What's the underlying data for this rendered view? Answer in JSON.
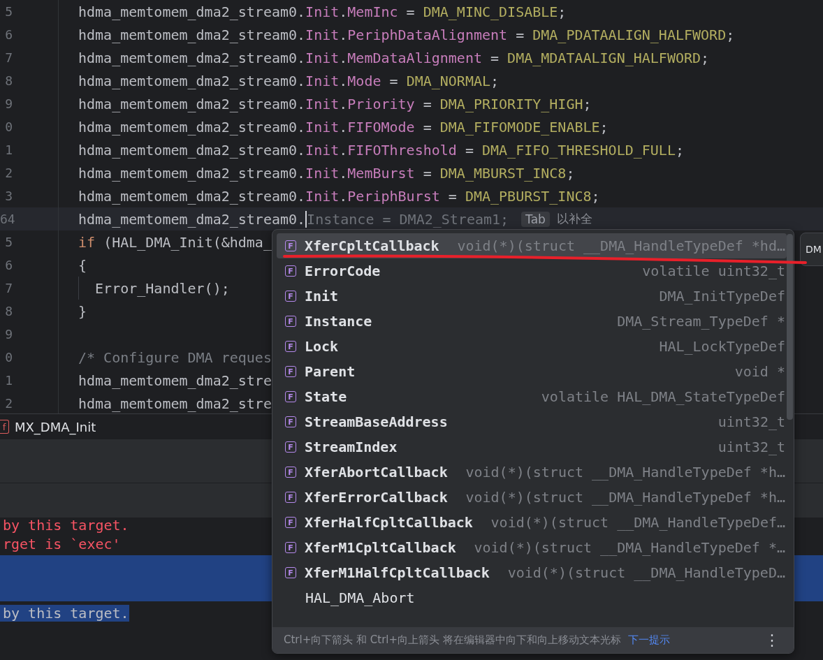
{
  "editor": {
    "lines": [
      {
        "number": "5",
        "current": false,
        "segments": [
          {
            "kind": "plain",
            "text": "hdma_memtomem_dma2_stream0."
          },
          {
            "kind": "field",
            "text": "Init"
          },
          {
            "kind": "plain",
            "text": "."
          },
          {
            "kind": "field",
            "text": "MemInc"
          },
          {
            "kind": "plain",
            "text": " = "
          },
          {
            "kind": "macro",
            "text": "DMA_MINC_DISABLE"
          },
          {
            "kind": "plain",
            "text": ";"
          }
        ]
      },
      {
        "number": "6",
        "current": false,
        "segments": [
          {
            "kind": "plain",
            "text": "hdma_memtomem_dma2_stream0."
          },
          {
            "kind": "field",
            "text": "Init"
          },
          {
            "kind": "plain",
            "text": "."
          },
          {
            "kind": "field",
            "text": "PeriphDataAlignment"
          },
          {
            "kind": "plain",
            "text": " = "
          },
          {
            "kind": "macro",
            "text": "DMA_PDATAALIGN_HALFWORD"
          },
          {
            "kind": "plain",
            "text": ";"
          }
        ]
      },
      {
        "number": "7",
        "current": false,
        "segments": [
          {
            "kind": "plain",
            "text": "hdma_memtomem_dma2_stream0."
          },
          {
            "kind": "field",
            "text": "Init"
          },
          {
            "kind": "plain",
            "text": "."
          },
          {
            "kind": "field",
            "text": "MemDataAlignment"
          },
          {
            "kind": "plain",
            "text": " = "
          },
          {
            "kind": "macro",
            "text": "DMA_MDATAALIGN_HALFWORD"
          },
          {
            "kind": "plain",
            "text": ";"
          }
        ]
      },
      {
        "number": "8",
        "current": false,
        "segments": [
          {
            "kind": "plain",
            "text": "hdma_memtomem_dma2_stream0."
          },
          {
            "kind": "field",
            "text": "Init"
          },
          {
            "kind": "plain",
            "text": "."
          },
          {
            "kind": "field",
            "text": "Mode"
          },
          {
            "kind": "plain",
            "text": " = "
          },
          {
            "kind": "macro",
            "text": "DMA_NORMAL"
          },
          {
            "kind": "plain",
            "text": ";"
          }
        ]
      },
      {
        "number": "9",
        "current": false,
        "segments": [
          {
            "kind": "plain",
            "text": "hdma_memtomem_dma2_stream0."
          },
          {
            "kind": "field",
            "text": "Init"
          },
          {
            "kind": "plain",
            "text": "."
          },
          {
            "kind": "field",
            "text": "Priority"
          },
          {
            "kind": "plain",
            "text": " = "
          },
          {
            "kind": "macro",
            "text": "DMA_PRIORITY_HIGH"
          },
          {
            "kind": "plain",
            "text": ";"
          }
        ]
      },
      {
        "number": "0",
        "current": false,
        "segments": [
          {
            "kind": "plain",
            "text": "hdma_memtomem_dma2_stream0."
          },
          {
            "kind": "field",
            "text": "Init"
          },
          {
            "kind": "plain",
            "text": "."
          },
          {
            "kind": "field",
            "text": "FIFOMode"
          },
          {
            "kind": "plain",
            "text": " = "
          },
          {
            "kind": "macro",
            "text": "DMA_FIFOMODE_ENABLE"
          },
          {
            "kind": "plain",
            "text": ";"
          }
        ]
      },
      {
        "number": "1",
        "current": false,
        "segments": [
          {
            "kind": "plain",
            "text": "hdma_memtomem_dma2_stream0."
          },
          {
            "kind": "field",
            "text": "Init"
          },
          {
            "kind": "plain",
            "text": "."
          },
          {
            "kind": "field",
            "text": "FIFOThreshold"
          },
          {
            "kind": "plain",
            "text": " = "
          },
          {
            "kind": "macro",
            "text": "DMA_FIFO_THRESHOLD_FULL"
          },
          {
            "kind": "plain",
            "text": ";"
          }
        ]
      },
      {
        "number": "2",
        "current": false,
        "segments": [
          {
            "kind": "plain",
            "text": "hdma_memtomem_dma2_stream0."
          },
          {
            "kind": "field",
            "text": "Init"
          },
          {
            "kind": "plain",
            "text": "."
          },
          {
            "kind": "field",
            "text": "MemBurst"
          },
          {
            "kind": "plain",
            "text": " = "
          },
          {
            "kind": "macro",
            "text": "DMA_MBURST_INC8"
          },
          {
            "kind": "plain",
            "text": ";"
          }
        ]
      },
      {
        "number": "3",
        "current": false,
        "segments": [
          {
            "kind": "plain",
            "text": "hdma_memtomem_dma2_stream0."
          },
          {
            "kind": "field",
            "text": "Init"
          },
          {
            "kind": "plain",
            "text": "."
          },
          {
            "kind": "field",
            "text": "PeriphBurst"
          },
          {
            "kind": "plain",
            "text": " = "
          },
          {
            "kind": "macro",
            "text": "DMA_PBURST_INC8"
          },
          {
            "kind": "plain",
            "text": ";"
          }
        ]
      },
      {
        "number": "64",
        "current": true,
        "segments": [
          {
            "kind": "plain",
            "text": "hdma_memtomem_dma2_stream0."
          },
          {
            "kind": "ghost",
            "text": "Instance = DMA2_Stream1;"
          }
        ],
        "hint": {
          "key": "Tab",
          "text": "以补全"
        }
      },
      {
        "number": "5",
        "current": false,
        "segments": [
          {
            "kind": "keyword",
            "text": "if"
          },
          {
            "kind": "plain",
            "text": " (HAL_DMA_Init(&hdma_"
          }
        ]
      },
      {
        "number": "6",
        "current": false,
        "segments": [
          {
            "kind": "plain",
            "text": "{"
          }
        ]
      },
      {
        "number": "7",
        "current": false,
        "guide": true,
        "segments": [
          {
            "kind": "plain",
            "text": "  Error_Handler();"
          }
        ]
      },
      {
        "number": "8",
        "current": false,
        "segments": [
          {
            "kind": "plain",
            "text": "}"
          }
        ]
      },
      {
        "number": "9",
        "current": false
      },
      {
        "number": "0",
        "current": false,
        "segments": [
          {
            "kind": "comment",
            "text": "/* Configure DMA reques"
          }
        ]
      },
      {
        "number": "1",
        "current": false,
        "segments": [
          {
            "kind": "plain",
            "text": "hdma_memtomem_dma2_stre"
          }
        ]
      },
      {
        "number": "2",
        "current": false,
        "segments": [
          {
            "kind": "plain",
            "text": "hdma_memtomem_dma2_stre"
          }
        ]
      }
    ]
  },
  "breadcrumb": {
    "icon": "f",
    "label": "MX_DMA_Init"
  },
  "terminal": {
    "lines": [
      {
        "kind": "error",
        "text": "by this target.",
        "selected": false
      },
      {
        "kind": "error",
        "text": "rget is `exec'",
        "selected": false
      },
      {
        "kind": "blank",
        "selected": true
      },
      {
        "kind": "blank",
        "selected": true
      },
      {
        "kind": "plain",
        "text": "by this target.",
        "selected": true
      }
    ]
  },
  "completion": {
    "items": [
      {
        "kind": "field",
        "badge": "F",
        "name": "XferCpltCallback",
        "type": "void(*)(struct __DMA_HandleTypeDef *hd…",
        "selected": true
      },
      {
        "kind": "field",
        "badge": "F",
        "name": "ErrorCode",
        "type": "volatile uint32_t",
        "selected": false
      },
      {
        "kind": "field",
        "badge": "F",
        "name": "Init",
        "type": "DMA_InitTypeDef",
        "selected": false
      },
      {
        "kind": "field",
        "badge": "F",
        "name": "Instance",
        "type": "DMA_Stream_TypeDef *",
        "selected": false
      },
      {
        "kind": "field",
        "badge": "F",
        "name": "Lock",
        "type": "HAL_LockTypeDef",
        "selected": false
      },
      {
        "kind": "field",
        "badge": "F",
        "name": "Parent",
        "type": "void *",
        "selected": false
      },
      {
        "kind": "field",
        "badge": "F",
        "name": "State",
        "type": "volatile HAL_DMA_StateTypeDef",
        "selected": false
      },
      {
        "kind": "field",
        "badge": "F",
        "name": "StreamBaseAddress",
        "type": "uint32_t",
        "selected": false
      },
      {
        "kind": "field",
        "badge": "F",
        "name": "StreamIndex",
        "type": "uint32_t",
        "selected": false
      },
      {
        "kind": "field",
        "badge": "F",
        "name": "XferAbortCallback",
        "type": "void(*)(struct __DMA_HandleTypeDef *h…",
        "selected": false
      },
      {
        "kind": "field",
        "badge": "F",
        "name": "XferErrorCallback",
        "type": "void(*)(struct __DMA_HandleTypeDef *h…",
        "selected": false
      },
      {
        "kind": "field",
        "badge": "F",
        "name": "XferHalfCpltCallback",
        "type": "void(*)(struct __DMA_HandleTypeDef…",
        "selected": false
      },
      {
        "kind": "field",
        "badge": "F",
        "name": "XferM1CpltCallback",
        "type": "void(*)(struct __DMA_HandleTypeDef *…",
        "selected": false
      },
      {
        "kind": "field",
        "badge": "F",
        "name": "XferM1HalfCpltCallback",
        "type": "void(*)(struct __DMA_HandleTypeD…",
        "selected": false
      },
      {
        "kind": "function",
        "name": "HAL_DMA_Abort",
        "selected": false
      }
    ],
    "footer": {
      "text": "Ctrl+向下箭头 和 Ctrl+向上箭头 将在编辑器中向下和向上移动文本光标",
      "link": "下一提示",
      "menu": "⋮"
    }
  },
  "side_popup": {
    "text": "DM"
  }
}
